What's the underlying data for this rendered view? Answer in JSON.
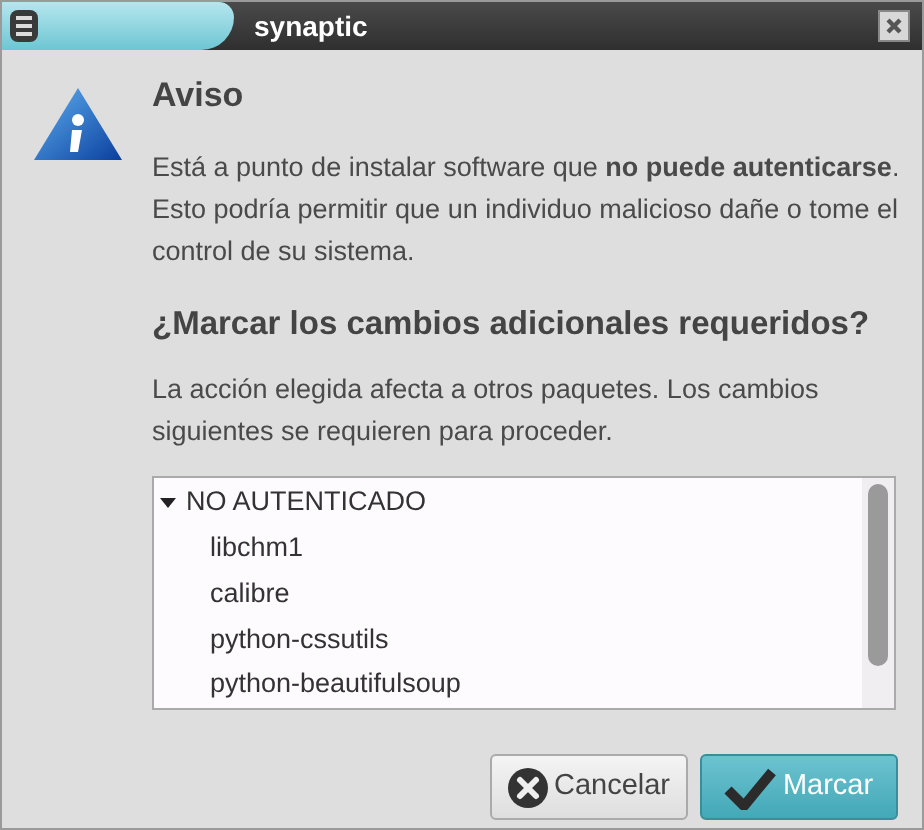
{
  "window": {
    "title": "synaptic"
  },
  "heading": "Aviso",
  "message": "Está a punto de instalar software que **no puede autenticarse**. Esto podría permitir que un individuo malicioso dañe o tome el control de su sistema.",
  "question": "¿Marcar los cambios adicionales requeridos?",
  "explanation": "La acción elegida afecta a otros paquetes. Los cambios siguientes se requieren para proceder.",
  "tree": {
    "label": "NO AUTENTICADO",
    "expanded": true,
    "children": [
      {
        "label": "libchm1"
      },
      {
        "label": "calibre"
      },
      {
        "label": "python-cssutils"
      },
      {
        "label": "python-beautifulsoup"
      }
    ]
  },
  "buttons": [
    {
      "label": "Cancelar",
      "kind": "cancel"
    },
    {
      "label": "Marcar",
      "kind": "confirm"
    }
  ]
}
